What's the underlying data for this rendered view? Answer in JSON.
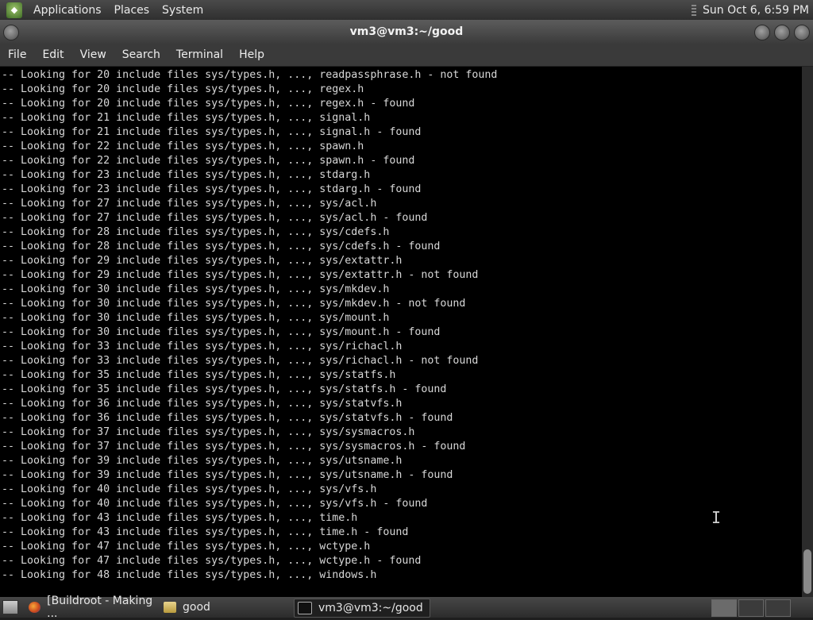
{
  "top_panel": {
    "menus": [
      "Applications",
      "Places",
      "System"
    ],
    "clock": "Sun Oct  6,  6:59 PM"
  },
  "window": {
    "title": "vm3@vm3:~/good",
    "menu": [
      "File",
      "Edit",
      "View",
      "Search",
      "Terminal",
      "Help"
    ]
  },
  "terminal": {
    "lines": [
      "-- Looking for 20 include files sys/types.h, ..., readpassphrase.h - not found",
      "-- Looking for 20 include files sys/types.h, ..., regex.h",
      "-- Looking for 20 include files sys/types.h, ..., regex.h - found",
      "-- Looking for 21 include files sys/types.h, ..., signal.h",
      "-- Looking for 21 include files sys/types.h, ..., signal.h - found",
      "-- Looking for 22 include files sys/types.h, ..., spawn.h",
      "-- Looking for 22 include files sys/types.h, ..., spawn.h - found",
      "-- Looking for 23 include files sys/types.h, ..., stdarg.h",
      "-- Looking for 23 include files sys/types.h, ..., stdarg.h - found",
      "-- Looking for 27 include files sys/types.h, ..., sys/acl.h",
      "-- Looking for 27 include files sys/types.h, ..., sys/acl.h - found",
      "-- Looking for 28 include files sys/types.h, ..., sys/cdefs.h",
      "-- Looking for 28 include files sys/types.h, ..., sys/cdefs.h - found",
      "-- Looking for 29 include files sys/types.h, ..., sys/extattr.h",
      "-- Looking for 29 include files sys/types.h, ..., sys/extattr.h - not found",
      "-- Looking for 30 include files sys/types.h, ..., sys/mkdev.h",
      "-- Looking for 30 include files sys/types.h, ..., sys/mkdev.h - not found",
      "-- Looking for 30 include files sys/types.h, ..., sys/mount.h",
      "-- Looking for 30 include files sys/types.h, ..., sys/mount.h - found",
      "-- Looking for 33 include files sys/types.h, ..., sys/richacl.h",
      "-- Looking for 33 include files sys/types.h, ..., sys/richacl.h - not found",
      "-- Looking for 35 include files sys/types.h, ..., sys/statfs.h",
      "-- Looking for 35 include files sys/types.h, ..., sys/statfs.h - found",
      "-- Looking for 36 include files sys/types.h, ..., sys/statvfs.h",
      "-- Looking for 36 include files sys/types.h, ..., sys/statvfs.h - found",
      "-- Looking for 37 include files sys/types.h, ..., sys/sysmacros.h",
      "-- Looking for 37 include files sys/types.h, ..., sys/sysmacros.h - found",
      "-- Looking for 39 include files sys/types.h, ..., sys/utsname.h",
      "-- Looking for 39 include files sys/types.h, ..., sys/utsname.h - found",
      "-- Looking for 40 include files sys/types.h, ..., sys/vfs.h",
      "-- Looking for 40 include files sys/types.h, ..., sys/vfs.h - found",
      "-- Looking for 43 include files sys/types.h, ..., time.h",
      "-- Looking for 43 include files sys/types.h, ..., time.h - found",
      "-- Looking for 47 include files sys/types.h, ..., wctype.h",
      "-- Looking for 47 include files sys/types.h, ..., wctype.h - found",
      "-- Looking for 48 include files sys/types.h, ..., windows.h"
    ]
  },
  "taskbar": {
    "tasks": [
      {
        "label": "[Buildroot - Making ...",
        "icon": "firefox-icon"
      },
      {
        "label": "good",
        "icon": "folder-icon"
      },
      {
        "label": "vm3@vm3:~/good",
        "icon": "terminal-icon"
      }
    ]
  },
  "colors": {
    "terminal_bg": "#000000",
    "terminal_fg": "#d8d8d8",
    "panel_bg": "#3a3a3a"
  }
}
